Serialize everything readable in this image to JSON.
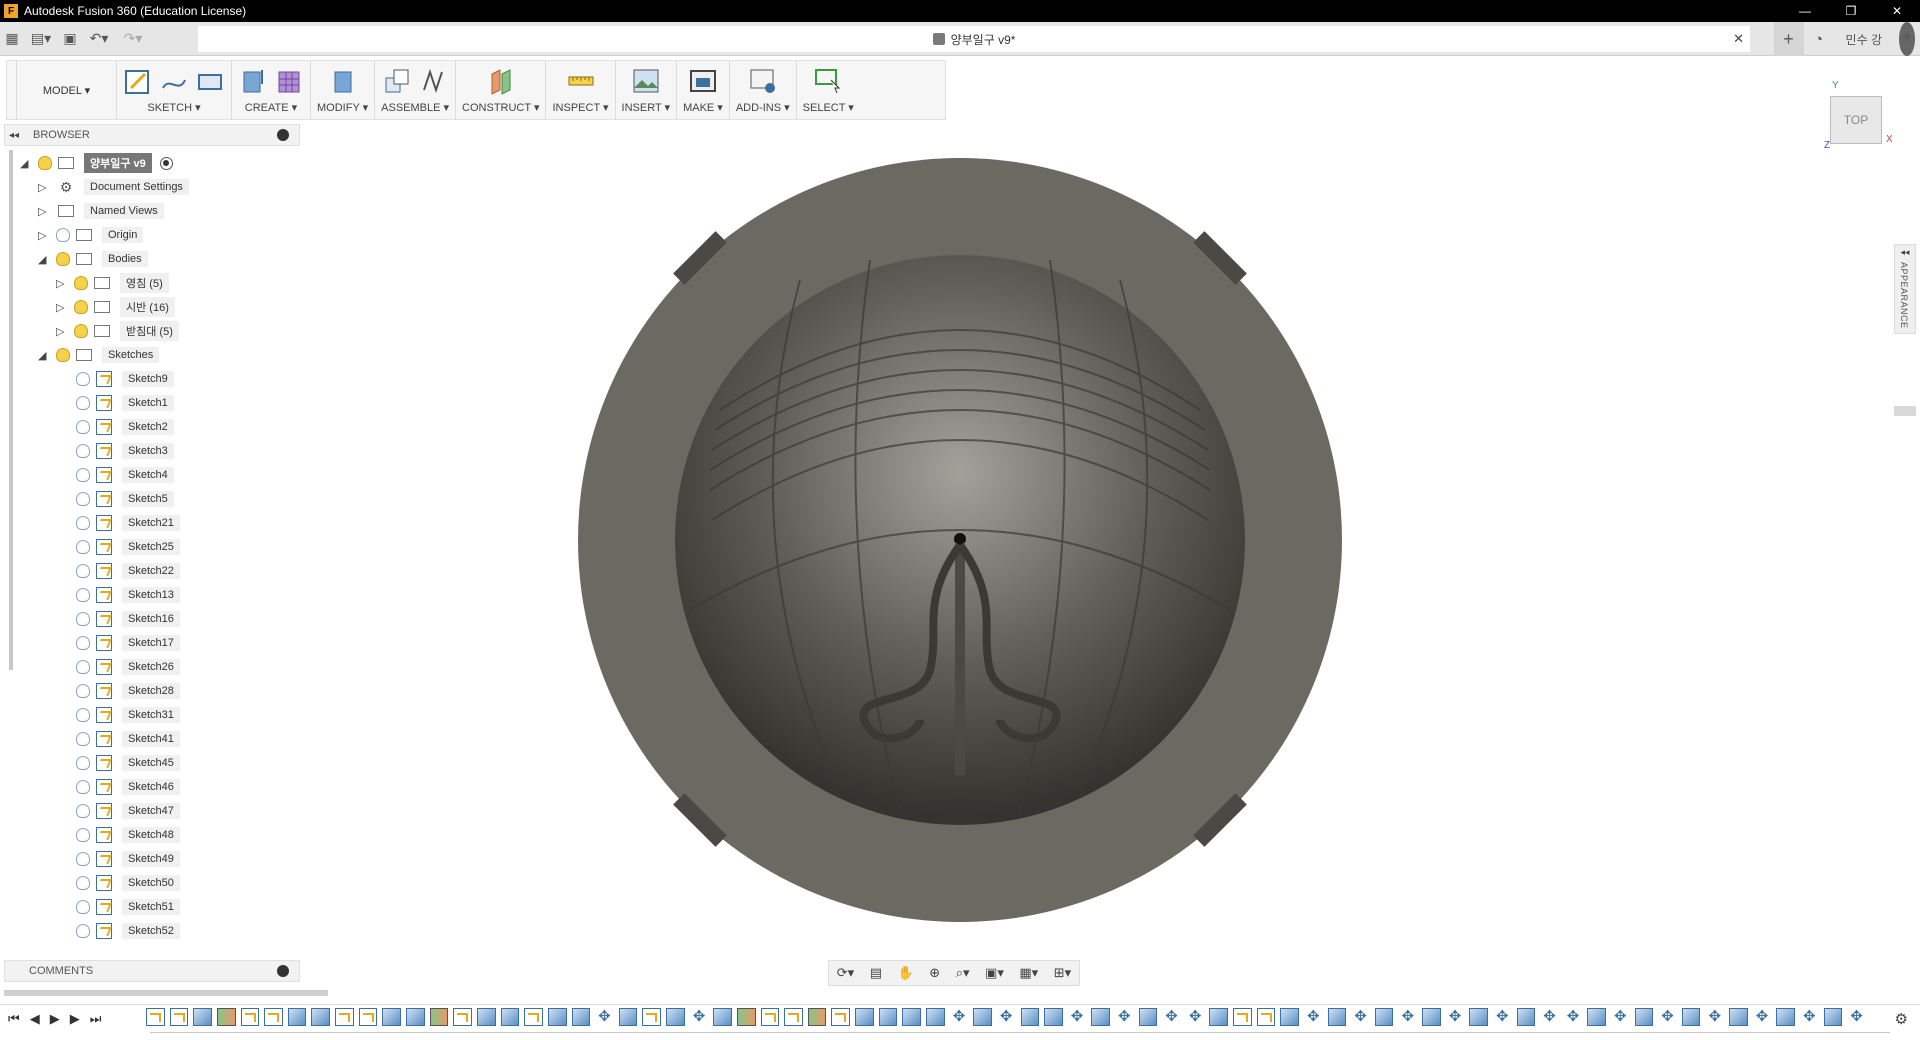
{
  "window": {
    "title": "Autodesk Fusion 360 (Education License)",
    "app_icon": "F",
    "controls": [
      "—",
      "❐",
      "✕"
    ]
  },
  "tabbar": {
    "document_title": "양부일구 v9*",
    "close": "✕",
    "user": "민수 강",
    "help": "?"
  },
  "ribbon": {
    "workspace": "MODEL ▾",
    "groups": [
      {
        "label": "SKETCH ▾"
      },
      {
        "label": "CREATE ▾"
      },
      {
        "label": "MODIFY ▾"
      },
      {
        "label": "ASSEMBLE ▾"
      },
      {
        "label": "CONSTRUCT ▾"
      },
      {
        "label": "INSPECT ▾"
      },
      {
        "label": "INSERT ▾"
      },
      {
        "label": "MAKE ▾"
      },
      {
        "label": "ADD-INS ▾"
      },
      {
        "label": "SELECT ▾"
      }
    ]
  },
  "browser": {
    "title": "BROWSER",
    "collapse": "◂◂",
    "root": "양부일구 v9",
    "items": {
      "document_settings": "Document Settings",
      "named_views": "Named Views",
      "origin": "Origin",
      "bodies": "Bodies",
      "body1": "영침 (5)",
      "body2": "시반 (16)",
      "body3": "받침대 (5)",
      "sketches": "Sketches"
    },
    "sketches": [
      "Sketch9",
      "Sketch1",
      "Sketch2",
      "Sketch3",
      "Sketch4",
      "Sketch5",
      "Sketch21",
      "Sketch25",
      "Sketch22",
      "Sketch13",
      "Sketch16",
      "Sketch17",
      "Sketch26",
      "Sketch28",
      "Sketch31",
      "Sketch41",
      "Sketch45",
      "Sketch46",
      "Sketch47",
      "Sketch48",
      "Sketch49",
      "Sketch50",
      "Sketch51",
      "Sketch52"
    ]
  },
  "comments": {
    "title": "COMMENTS"
  },
  "viewcube": {
    "face": "TOP",
    "x": "X",
    "y": "Y",
    "z": "Z"
  },
  "appearance_tab": {
    "label": "APPEARANCE",
    "arrow": "◂◂"
  },
  "colors": {
    "model": "#6b6a62",
    "sphere_dark": "#3e3d39",
    "sphere_light": "#8a8882",
    "accent": "#3b6fa0"
  }
}
